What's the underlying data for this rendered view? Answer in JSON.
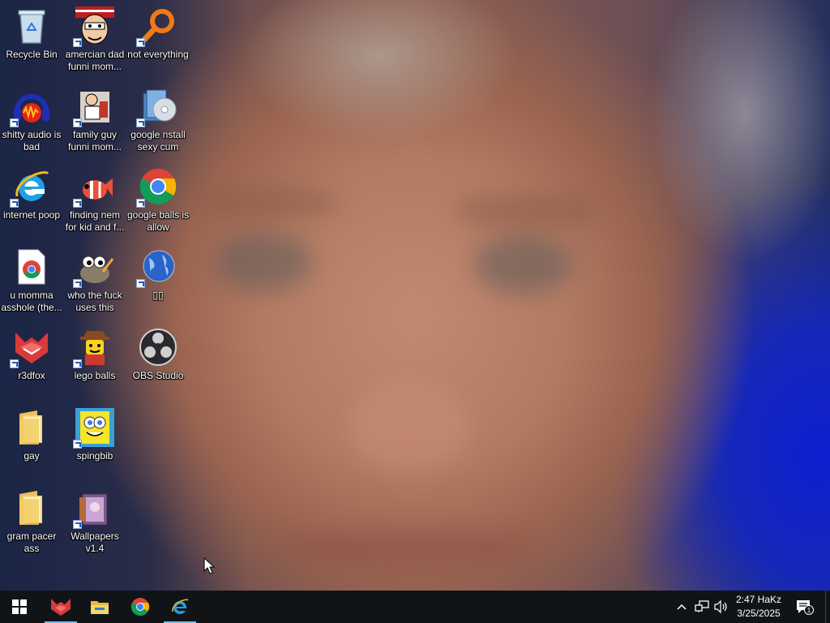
{
  "desktop": {
    "icons": [
      {
        "id": "recycle-bin",
        "label": "Recycle Bin"
      },
      {
        "id": "amercian-dad",
        "label": "amercian dad funni mom..."
      },
      {
        "id": "not-everything",
        "label": "not everything"
      },
      {
        "id": "shitty-audio",
        "label": "shitty audio is bad"
      },
      {
        "id": "family-guy",
        "label": "family guy funni mom..."
      },
      {
        "id": "google-install",
        "label": "google nstall sexy cum"
      },
      {
        "id": "internet-poop",
        "label": "internet poop"
      },
      {
        "id": "finding-nem",
        "label": "finding nem for kid and f..."
      },
      {
        "id": "google-balls",
        "label": "google balls is allow"
      },
      {
        "id": "u-momma",
        "label": "u momma asshole (the..."
      },
      {
        "id": "gimp",
        "label": "who the fuck uses this"
      },
      {
        "id": "globe",
        "label": "▯▯"
      },
      {
        "id": "r3dfox",
        "label": "r3dfox"
      },
      {
        "id": "lego-balls",
        "label": "lego balls"
      },
      {
        "id": "obs-studio",
        "label": "OBS Studio"
      },
      {
        "id": "gay",
        "label": "gay"
      },
      {
        "id": "spingbib",
        "label": "spingbib"
      },
      {
        "id": "gram-pacer",
        "label": "gram pacer ass"
      },
      {
        "id": "wallpapers",
        "label": "Wallpapers v1.4"
      }
    ]
  },
  "taskbar": {
    "start_icon": "windows-logo-icon",
    "pinned": [
      {
        "name": "r3dfox",
        "icon": "r3dfox-icon",
        "active": true
      },
      {
        "name": "File Explorer",
        "icon": "folder-icon",
        "active": false
      },
      {
        "name": "Google Chrome",
        "icon": "chrome-icon",
        "active": false
      },
      {
        "name": "Internet Explorer",
        "icon": "internet-explorer-icon",
        "active": true
      }
    ],
    "tray": {
      "time": "2:47 HaKz",
      "date": "3/25/2025",
      "notification_count": "1"
    }
  },
  "colors": {
    "taskbar_bg": "#101417",
    "active_indicator": "#76b9ed"
  }
}
